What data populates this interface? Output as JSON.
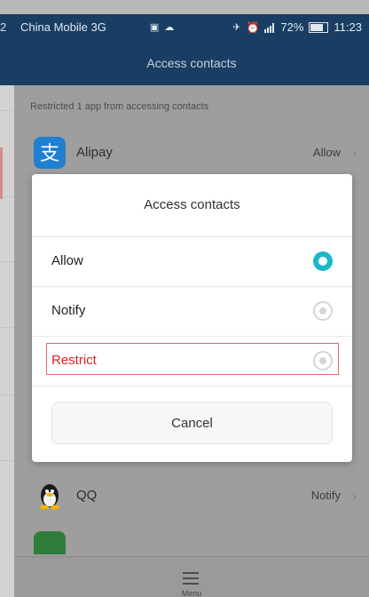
{
  "status_bar": {
    "left_time_partial": "2",
    "carrier": "China Mobile 3G",
    "battery": "72%",
    "time": "11:23"
  },
  "header": {
    "title": "Access contacts"
  },
  "list": {
    "subtitle": "Restricted 1 app from accessing contacts",
    "items": [
      {
        "name": "Alipay",
        "status": "Allow",
        "icon": "alipay-icon"
      },
      {
        "name": "QQ",
        "status": "Notify",
        "icon": "qq-penguin-icon"
      }
    ]
  },
  "dialog": {
    "title": "Access contacts",
    "options": [
      {
        "label": "Allow",
        "selected": true
      },
      {
        "label": "Notify",
        "selected": false
      },
      {
        "label": "Restrict",
        "selected": false
      }
    ],
    "cancel": "Cancel"
  },
  "bottom": {
    "menu_label": "Menu"
  },
  "colors": {
    "header_bg": "#1a3e63",
    "radio_selected": "#1bb7c9",
    "restrict_text": "#e02424",
    "restrict_border": "#e06a6a"
  }
}
